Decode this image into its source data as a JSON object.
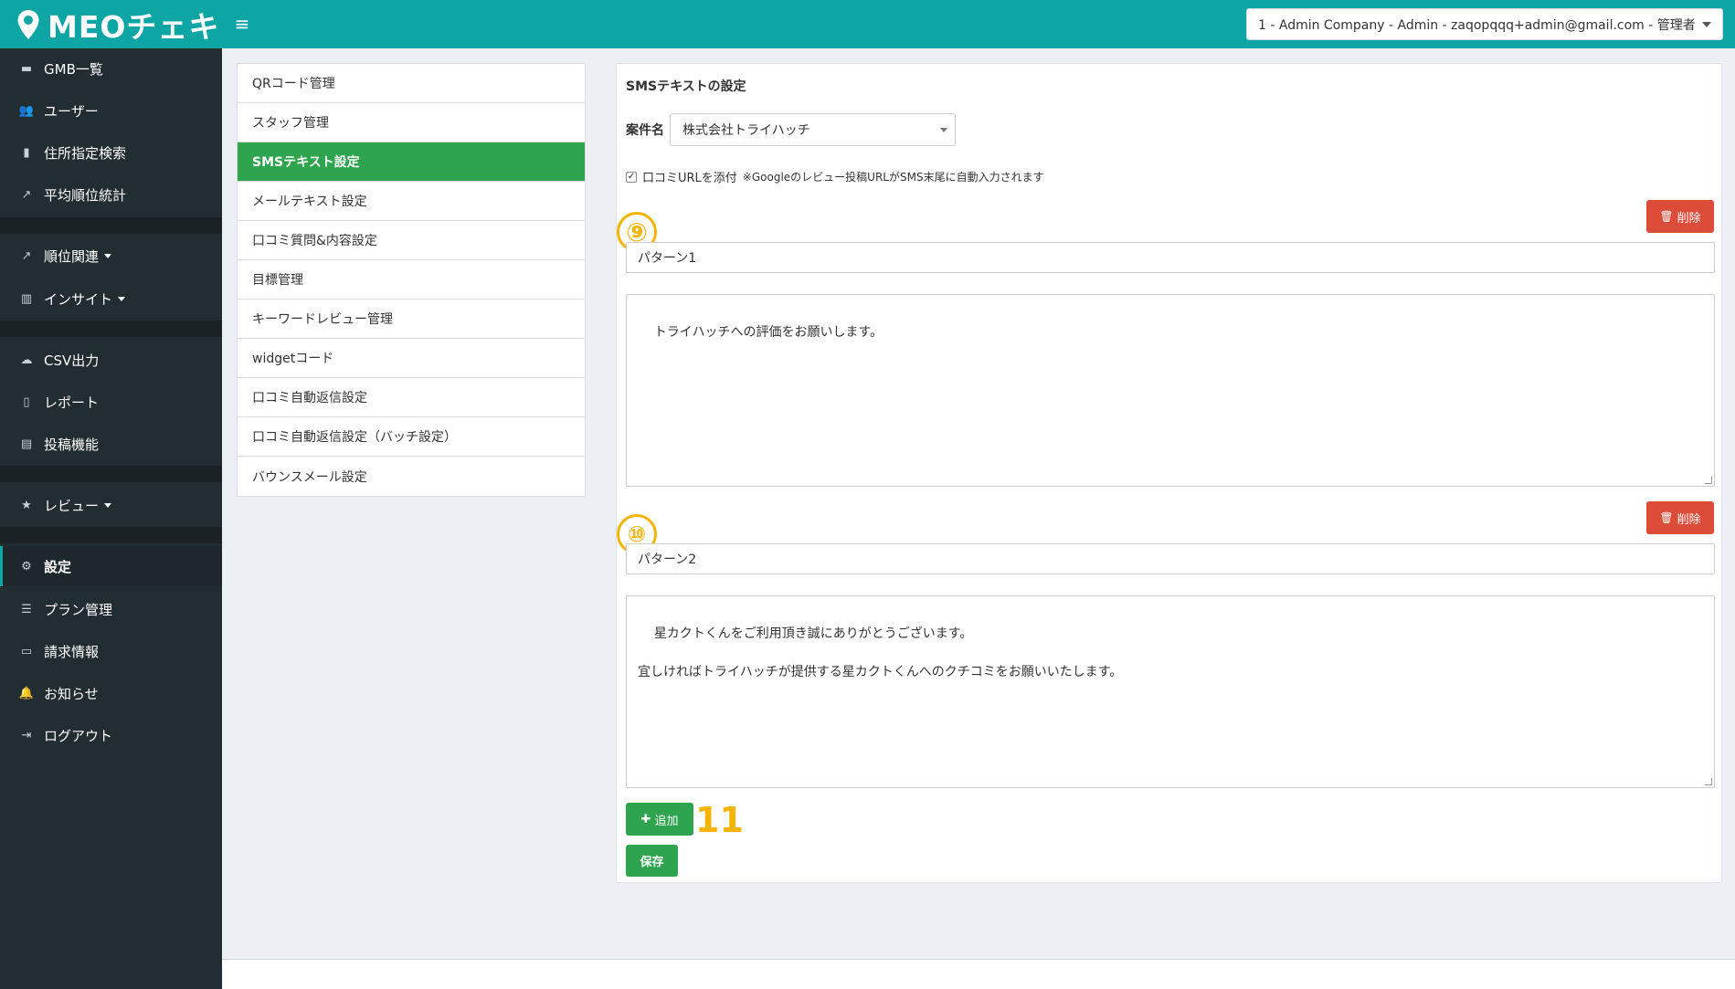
{
  "header": {
    "logo_text": "MEOチェキ",
    "account": "1 - Admin Company - Admin - zaqopqqq+admin@gmail.com - 管理者"
  },
  "sidebar": {
    "items": [
      {
        "label": "GMB一覧",
        "icon": "briefcase-icon"
      },
      {
        "label": "ユーザー",
        "icon": "users-icon"
      },
      {
        "label": "住所指定検索",
        "icon": "map-icon"
      },
      {
        "label": "平均順位統計",
        "icon": "line-chart-icon"
      },
      {
        "label": "順位関連",
        "icon": "line-chart-icon"
      },
      {
        "label": "インサイト",
        "icon": "bar-chart-icon"
      },
      {
        "label": "CSV出力",
        "icon": "cloud-download-icon"
      },
      {
        "label": "レポート",
        "icon": "file-icon"
      },
      {
        "label": "投稿機能",
        "icon": "newspaper-icon"
      },
      {
        "label": "レビュー",
        "icon": "star-icon"
      },
      {
        "label": "設定",
        "icon": "gear-icon"
      },
      {
        "label": "プラン管理",
        "icon": "list-icon"
      },
      {
        "label": "請求情報",
        "icon": "credit-card-icon"
      },
      {
        "label": "お知らせ",
        "icon": "bell-icon"
      },
      {
        "label": "ログアウト",
        "icon": "sign-out-icon"
      }
    ]
  },
  "settings_menu": {
    "items": [
      "QRコード管理",
      "スタッフ管理",
      "SMSテキスト設定",
      "メールテキスト設定",
      "口コミ質問&内容設定",
      "目標管理",
      "キーワードレビュー管理",
      "widgetコード",
      "口コミ自動返信設定",
      "口コミ自動返信設定（バッチ設定）",
      "バウンスメール設定"
    ],
    "active": "SMSテキスト設定"
  },
  "main": {
    "title": "SMSテキストの設定",
    "case_label": "案件名",
    "case_value": "株式会社トライハッチ",
    "attach_label": "口コミURLを添付",
    "attach_note": "※Googleのレビュー投稿URLがSMS末尾に自動入力されます",
    "delete_label": "削除",
    "patterns": [
      {
        "name": "パターン1",
        "text": "トライハッチへの評価をお願いします。",
        "marker": "⑨"
      },
      {
        "name": "パターン2",
        "text": "星カクトくんをご利用頂き誠にありがとうございます。\n\n宜しければトライハッチが提供する星カクトくんへのクチコミをお願いいたします。",
        "marker": "⑩"
      }
    ],
    "add_label": "追加",
    "add_marker": "11",
    "save_label": "保存"
  },
  "colors": {
    "header": "#0ea5a5",
    "sidebar": "#222d32",
    "active_menu": "#2ea44f",
    "delete": "#dd4b39",
    "marker": "#f5b400"
  }
}
